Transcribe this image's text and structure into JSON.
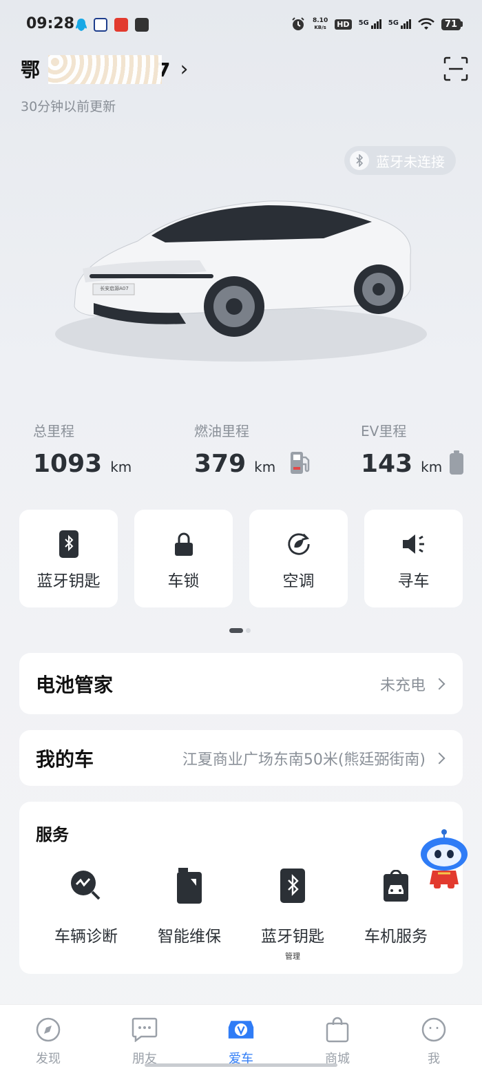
{
  "status_bar": {
    "time": "09:28",
    "net_speed_value": "8.10",
    "net_speed_unit": "KB/s",
    "hd_label": "HD",
    "sim1_label": "5G",
    "sim2_label": "5G",
    "battery": "71"
  },
  "header": {
    "plate_prefix": "鄂",
    "plate_suffix": "7",
    "update_time": "30分钟以前更新"
  },
  "bluetooth_status": "蓝牙未连接",
  "car_badge": "长安启源A07",
  "stats": [
    {
      "label": "总里程",
      "value": "1093",
      "unit": "km"
    },
    {
      "label": "燃油里程",
      "value": "379",
      "unit": "km"
    },
    {
      "label": "EV里程",
      "value": "143",
      "unit": "km"
    }
  ],
  "quick_actions": [
    {
      "label": "蓝牙钥匙",
      "icon": "bluetooth-key-icon"
    },
    {
      "label": "车锁",
      "icon": "lock-icon"
    },
    {
      "label": "空调",
      "icon": "air-conditioner-icon"
    },
    {
      "label": "寻车",
      "icon": "speaker-icon"
    }
  ],
  "battery_manager": {
    "title": "电池管家",
    "status": "未充电"
  },
  "my_car": {
    "title": "我的车",
    "location": "江夏商业广场东南50米(熊廷弼街南)"
  },
  "services": {
    "title": "服务",
    "items": [
      {
        "label": "车辆诊断",
        "sub": "",
        "icon": "diagnosis-icon"
      },
      {
        "label": "智能维保",
        "sub": "",
        "icon": "maintenance-icon"
      },
      {
        "label": "蓝牙钥匙",
        "sub": "管理",
        "icon": "bluetooth-key-icon"
      },
      {
        "label": "车机服务",
        "sub": "",
        "icon": "car-service-icon"
      }
    ]
  },
  "tabbar": {
    "items": [
      {
        "label": "发现",
        "icon": "compass-icon"
      },
      {
        "label": "朋友",
        "icon": "chat-icon"
      },
      {
        "label": "爱车",
        "icon": "car-v-icon"
      },
      {
        "label": "商城",
        "icon": "shopping-bag-icon"
      },
      {
        "label": "我",
        "icon": "profile-icon"
      }
    ],
    "active_index": 2
  },
  "colors": {
    "accent": "#2f7cf6",
    "text": "#1f2329",
    "muted": "#8a9098"
  }
}
